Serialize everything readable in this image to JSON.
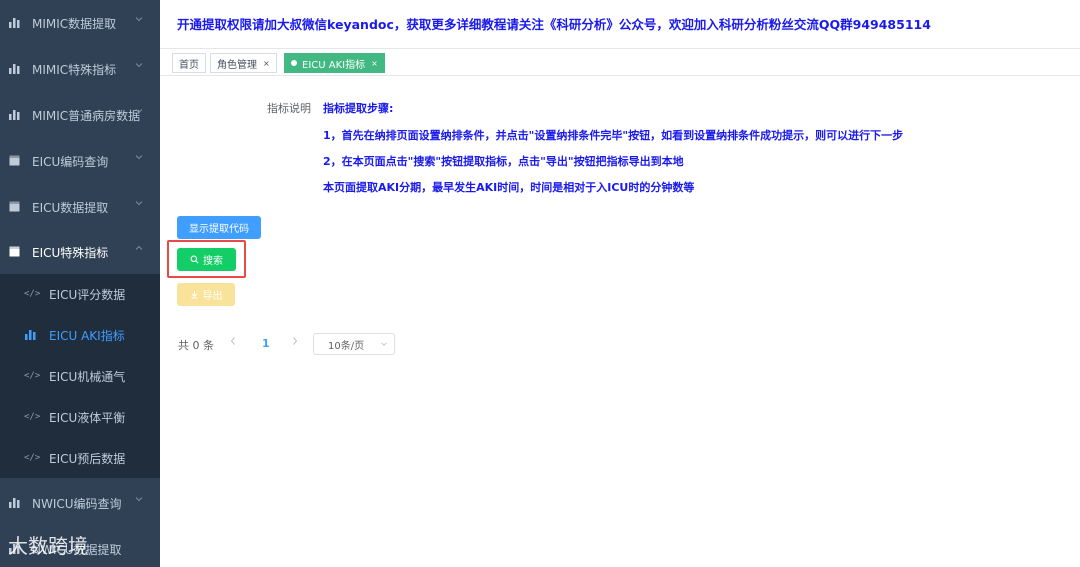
{
  "sidebar": {
    "items": [
      {
        "label": "MIMIC数据提取",
        "icon": "bar-chart-icon"
      },
      {
        "label": "MIMIC特殊指标",
        "icon": "bar-chart-icon"
      },
      {
        "label": "MIMIC普通病房数据",
        "icon": "bar-chart-icon"
      },
      {
        "label": "EICU编码查询",
        "icon": "document-icon"
      },
      {
        "label": "EICU数据提取",
        "icon": "document-icon"
      },
      {
        "label": "EICU特殊指标",
        "icon": "document-icon"
      },
      {
        "label": "NWICU编码查询",
        "icon": "bar-chart-icon"
      },
      {
        "label": "NWICU数据提取",
        "icon": "bar-chart-icon"
      }
    ],
    "subitems": [
      {
        "label": "EICU评分数据",
        "icon": "code-icon"
      },
      {
        "label": "EICU AKI指标",
        "icon": "bar-chart-icon",
        "active": true
      },
      {
        "label": "EICU机械通气",
        "icon": "code-icon"
      },
      {
        "label": "EICU液体平衡",
        "icon": "code-icon"
      },
      {
        "label": "EICU预后数据",
        "icon": "code-icon"
      }
    ]
  },
  "watermark": "大数跨境",
  "notice": "开通提取权限请加大叔微信keyandoc，获取更多详细教程请关注《科研分析》公众号，欢迎加入科研分析粉丝交流QQ群949485114",
  "tabs": [
    {
      "label": "首页"
    },
    {
      "label": "角色管理"
    },
    {
      "label": "EICU AKI指标",
      "active": true
    }
  ],
  "description": {
    "label": "指标说明",
    "title": "指标提取步骤:",
    "step1": "1，首先在纳排页面设置纳排条件，并点击\"设置纳排条件完毕\"按钮，如看到设置纳排条件成功提示，则可以进行下一步",
    "step2": "2，在本页面点击\"搜索\"按钮提取指标，点击\"导出\"按钮把指标导出到本地",
    "note": "本页面提取AKI分期，最早发生AKI时间，时间是相对于入ICU时的分钟数等"
  },
  "buttons": {
    "show_code": "显示提取代码",
    "search": "搜索",
    "export": "导出"
  },
  "pagination": {
    "total": "共 0 条",
    "current_page": "1",
    "page_size": "10条/页"
  },
  "colors": {
    "sidebar_bg": "#304156",
    "submenu_bg": "#1f2d3d",
    "accent": "#409eff",
    "success": "#13ce66",
    "active_tab": "#42b983",
    "highlight": "#e84a4a"
  }
}
